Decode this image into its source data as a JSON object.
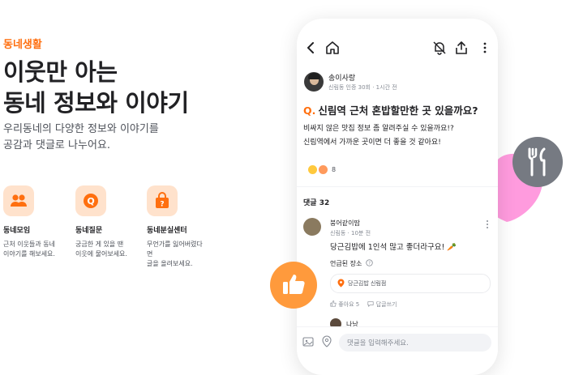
{
  "intro": {
    "eyebrow": "동네생활",
    "headline_line1": "이웃만 아는",
    "headline_line2": "동네 정보와 이야기",
    "desc_line1": "우리동네의 다양한 정보와 이야기를",
    "desc_line2": "공감과 댓글로 나누어요."
  },
  "features": [
    {
      "icon": "people-icon",
      "title": "동네모임",
      "desc_line1": "근처 이웃들과 동네",
      "desc_line2": "이야기를 해보세요.",
      "desc_line3": ""
    },
    {
      "icon": "question-icon",
      "title": "동네질문",
      "desc_line1": "궁금한 게 있을 땐",
      "desc_line2": "이웃에 물어보세요.",
      "desc_line3": ""
    },
    {
      "icon": "lost-bag-icon",
      "title": "동네분실센터",
      "desc_line1": "무언가를 잃어버렸다",
      "desc_line2": "면",
      "desc_line3": "글을 올려보세요."
    }
  ],
  "phone": {
    "author": {
      "name": "송이사랑",
      "meta": "신림동 인증 30회 · 1시간 전"
    },
    "question_prefix": "Q.",
    "question": "신림역 근처 혼밥할만한 곳 있을까요?",
    "body_line1": "비싸지 않은 맛집 정보 좀 알려주실 수 있을까요!?",
    "body_line2": "신림역에서 가까운 곳이면 더 좋을 것 같아요!",
    "reaction_count": "8",
    "comments_label": "댓글 32",
    "comment": {
      "name": "붕어같이땀",
      "meta": "신림동 · 10분 전",
      "text": "당근김밥에 1인석 많고 좋더라구요! 🥕",
      "place_label": "언급된 장소",
      "place": "당근김밥 신림점",
      "like": "좋아요 5",
      "reply": "답글쓰기"
    },
    "comment2_name": "나낭",
    "input_placeholder": "댓글을 입력해주세요."
  },
  "colors": {
    "brand": "#ff6f0f",
    "heart": "#ff9bde",
    "fork_bg": "#767a82",
    "thumb_bg": "#ff9a3c"
  }
}
